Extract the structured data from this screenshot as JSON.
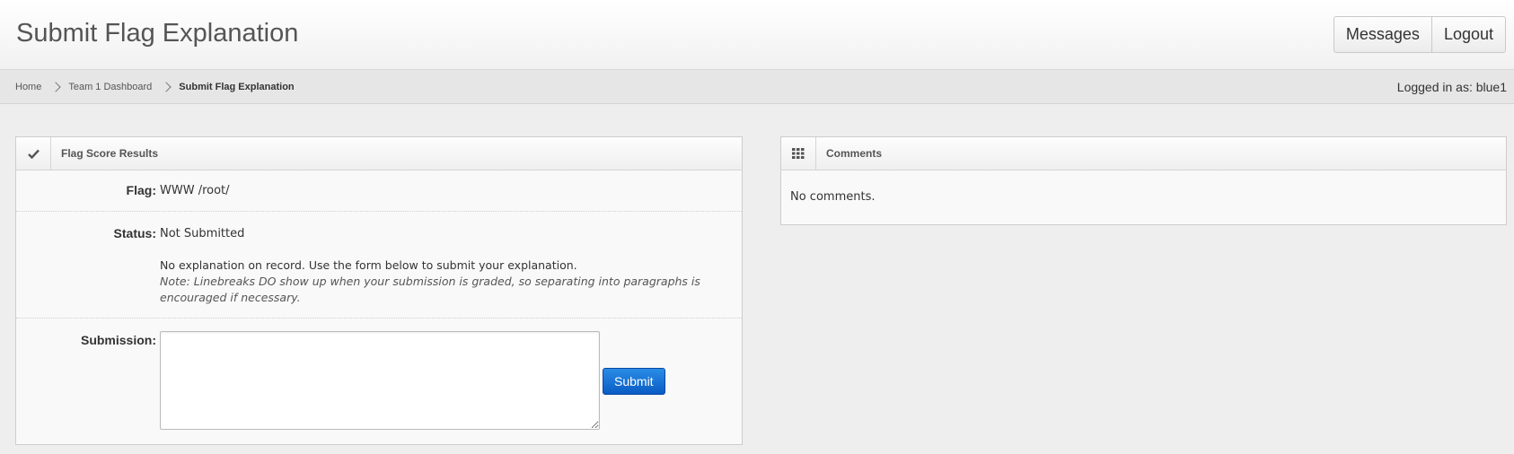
{
  "header": {
    "title": "Submit Flag Explanation",
    "buttons": {
      "messages": "Messages",
      "logout": "Logout"
    }
  },
  "breadcrumb": {
    "home": "Home",
    "dashboard": "Team 1 Dashboard",
    "current": "Submit Flag Explanation"
  },
  "user": {
    "logged_in_text": "Logged in as: blue1"
  },
  "flag_panel": {
    "title": "Flag Score Results",
    "icon": "check-icon",
    "flag_label": "Flag:",
    "flag_value": "WWW /root/",
    "status_label": "Status:",
    "status_value": "Not Submitted",
    "no_explanation": "No explanation on record. Use the form below to submit your explanation.",
    "note": "Note: Linebreaks DO show up when your submission is graded, so separating into paragraphs is encouraged if necessary.",
    "submission_label": "Submission:",
    "submission_value": "",
    "submit_label": "Submit"
  },
  "comments_panel": {
    "title": "Comments",
    "icon": "grid-icon",
    "empty_text": "No comments."
  },
  "colors": {
    "accent": "#0a5cc4",
    "background": "#eeeeee"
  }
}
